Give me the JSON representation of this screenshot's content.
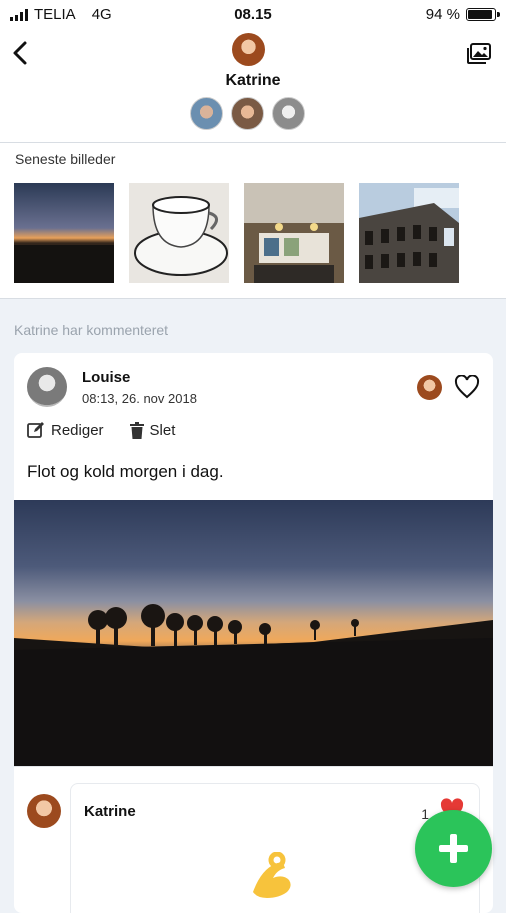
{
  "status_bar": {
    "carrier": "TELIA",
    "network": "4G",
    "time": "08.15",
    "battery": "94 %",
    "battery_level": 0.94
  },
  "header": {
    "back_icon": "chevron-left-icon",
    "title": "Katrine",
    "gallery_icon": "image-gallery-icon",
    "member_count": 3
  },
  "recent_photos": {
    "title": "Seneste billeder",
    "items": [
      "sunset",
      "coffee-cup",
      "kitchen",
      "colosseum"
    ]
  },
  "activity": {
    "label": "Katrine har kommenteret"
  },
  "post": {
    "author": "Louise",
    "timestamp": "08:13, 26. nov 2018",
    "edit_label": "Rediger",
    "delete_label": "Slet",
    "text": "Flot og kold morgen i dag.",
    "photo": "sunset-landscape"
  },
  "comment": {
    "author": "Katrine",
    "like_count": "1"
  },
  "fab": {
    "icon": "plus-icon"
  }
}
